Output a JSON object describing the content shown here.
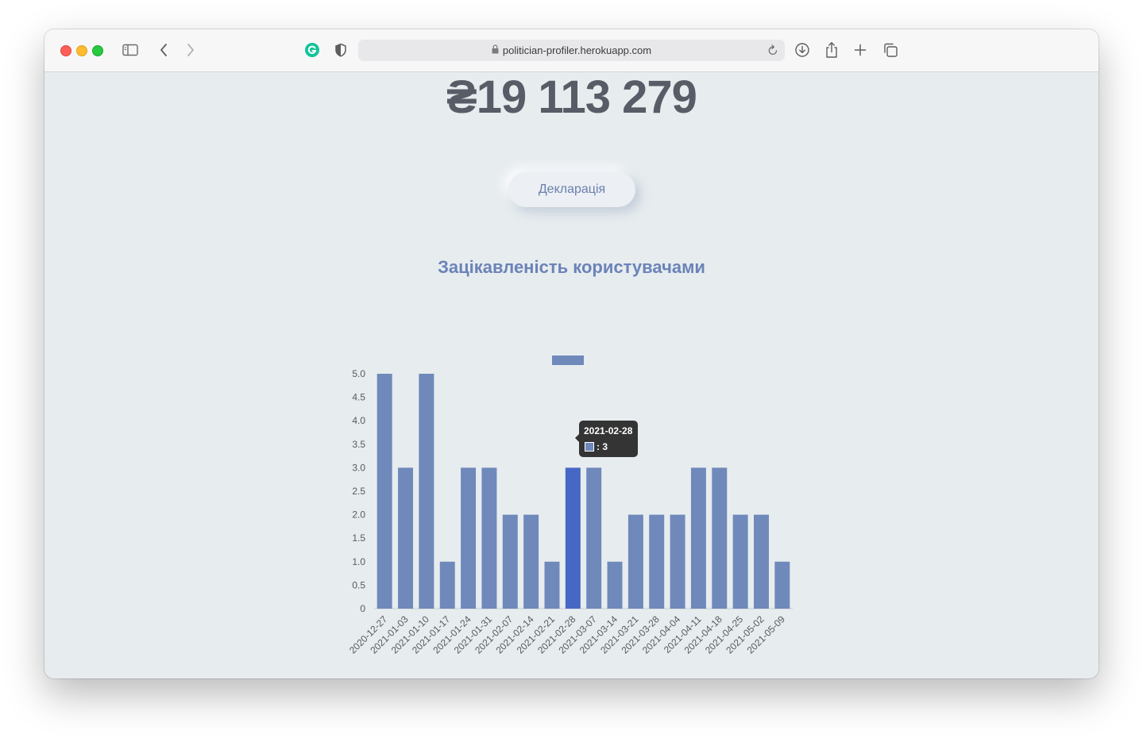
{
  "browser": {
    "url": "politician-profiler.herokuapp.com"
  },
  "page": {
    "amount": "₴19 113 279",
    "declaration_button": "Декларація",
    "section_title": "Зацікавленість користувачами"
  },
  "tooltip": {
    "title": "2021-02-28",
    "value_label": ": 3"
  },
  "colors": {
    "bar": "#6f89bb",
    "bar_highlight": "#4668c4",
    "legend_swatch": "#6f89bb"
  },
  "chart_data": {
    "type": "bar",
    "categories": [
      "2020-12-27",
      "2021-01-03",
      "2021-01-10",
      "2021-01-17",
      "2021-01-24",
      "2021-01-31",
      "2021-02-07",
      "2021-02-14",
      "2021-02-21",
      "2021-02-28",
      "2021-03-07",
      "2021-03-14",
      "2021-03-21",
      "2021-03-28",
      "2021-04-04",
      "2021-04-11",
      "2021-04-18",
      "2021-04-25",
      "2021-05-02",
      "2021-05-09"
    ],
    "values": [
      5,
      3,
      5,
      1,
      3,
      3,
      2,
      2,
      1,
      3,
      3,
      1,
      2,
      2,
      2,
      3,
      3,
      2,
      2,
      1
    ],
    "ylim": [
      0,
      5
    ],
    "yticks": [
      "0",
      "0.5",
      "1.0",
      "1.5",
      "2.0",
      "2.5",
      "3.0",
      "3.5",
      "4.0",
      "4.5",
      "5.0"
    ],
    "highlighted_category": "2021-02-28",
    "legend": "top-center",
    "grid": false
  }
}
